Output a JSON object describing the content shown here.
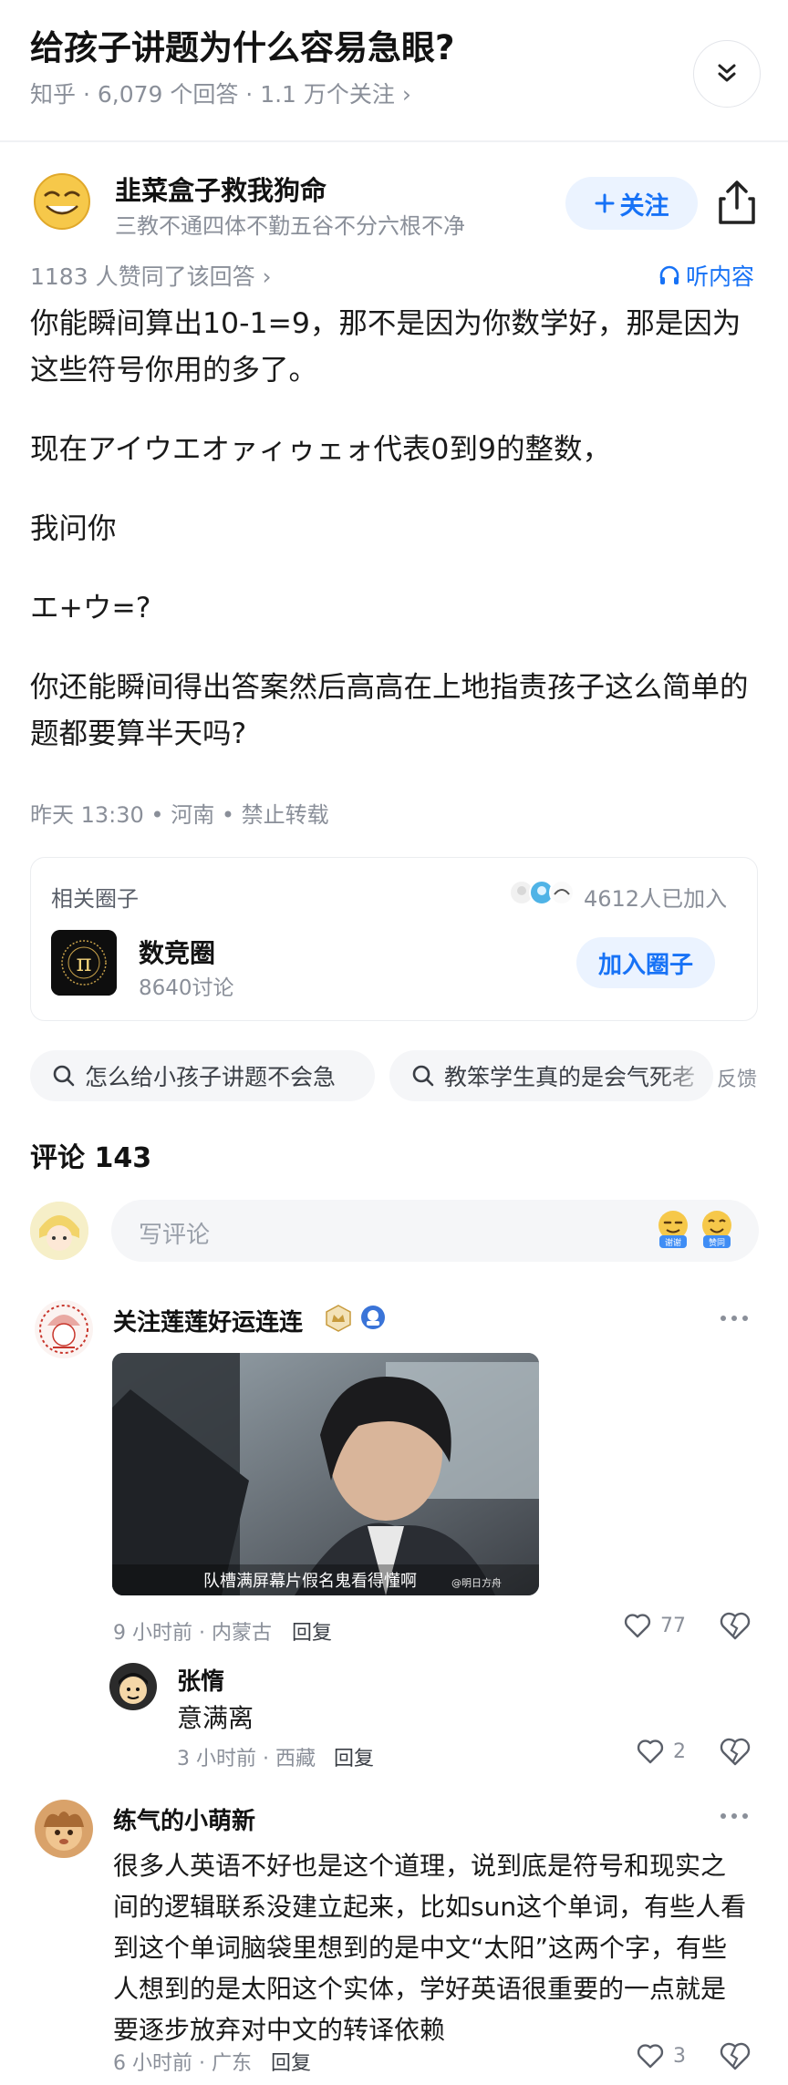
{
  "question": {
    "title": "给孩子讲题为什么容易急眼?",
    "meta": "知乎 · 6,079 个回答 · 1.1 万个关注 ›"
  },
  "author": {
    "name": "韭菜盒子救我狗命",
    "bio": "三教不通四体不勤五谷不分六根不净",
    "follow_label": "关注",
    "follow_icon": "plus-icon",
    "share_icon": "share-icon"
  },
  "answer": {
    "votes": "1183 人赞同了该回答 ›",
    "listen_label": "听内容",
    "paragraphs": [
      "你能瞬间算出10-1=9，那不是因为你数学好，那是因为这些符号你用的多了。",
      "现在アイウエオァィゥェォ代表0到9的整数，",
      "我问你",
      "エ+ウ=?",
      "你还能瞬间得出答案然后高高在上地指责孩子这么简单的题都要算半天吗?"
    ],
    "post_meta": "昨天 13:30 • 河南 • 禁止转载"
  },
  "circle": {
    "label": "相关圈子",
    "members": "4612人已加入",
    "name": "数竞圈",
    "discussions": "8640讨论",
    "join_label": "加入圈子",
    "logo_symbol": "π"
  },
  "related_searches": [
    {
      "text": "怎么给小孩子讲题不会急"
    },
    {
      "text": "教笨学生真的是会气死老"
    }
  ],
  "feedback_label": "反馈",
  "comments": {
    "title": "评论 143",
    "placeholder": "写评论",
    "emoji_labels": [
      "谢谢",
      "赞同"
    ],
    "items": [
      {
        "name": "关注莲莲好运连连",
        "time_loc": "9 小时前 · 内蒙古",
        "reply": "回复",
        "likes": "77",
        "image_caption": "队槽满屏幕片假名鬼看得懂啊",
        "image_watermark": "@明日方舟",
        "replies": [
          {
            "name": "张惰",
            "text": "意满离",
            "time_loc": "3 小时前 · 西藏",
            "reply": "回复",
            "likes": "2"
          }
        ]
      },
      {
        "name": "练气的小萌新",
        "text": "很多人英语不好也是这个道理，说到底是符号和现实之间的逻辑联系没建立起来，比如sun这个单词，有些人看到这个单词脑袋里想到的是中文“太阳”这两个字，有些人想到的是太阳这个实体，学好英语很重要的一点就是要逐步放弃对中文的转译依赖",
        "time_loc": "6 小时前 · 广东",
        "reply": "回复",
        "likes": "3"
      }
    ]
  },
  "colors": {
    "accent": "#1772f6",
    "accent_bg": "#ebf3ff",
    "muted": "#8a8f99",
    "chip_bg": "#f5f6f8"
  }
}
